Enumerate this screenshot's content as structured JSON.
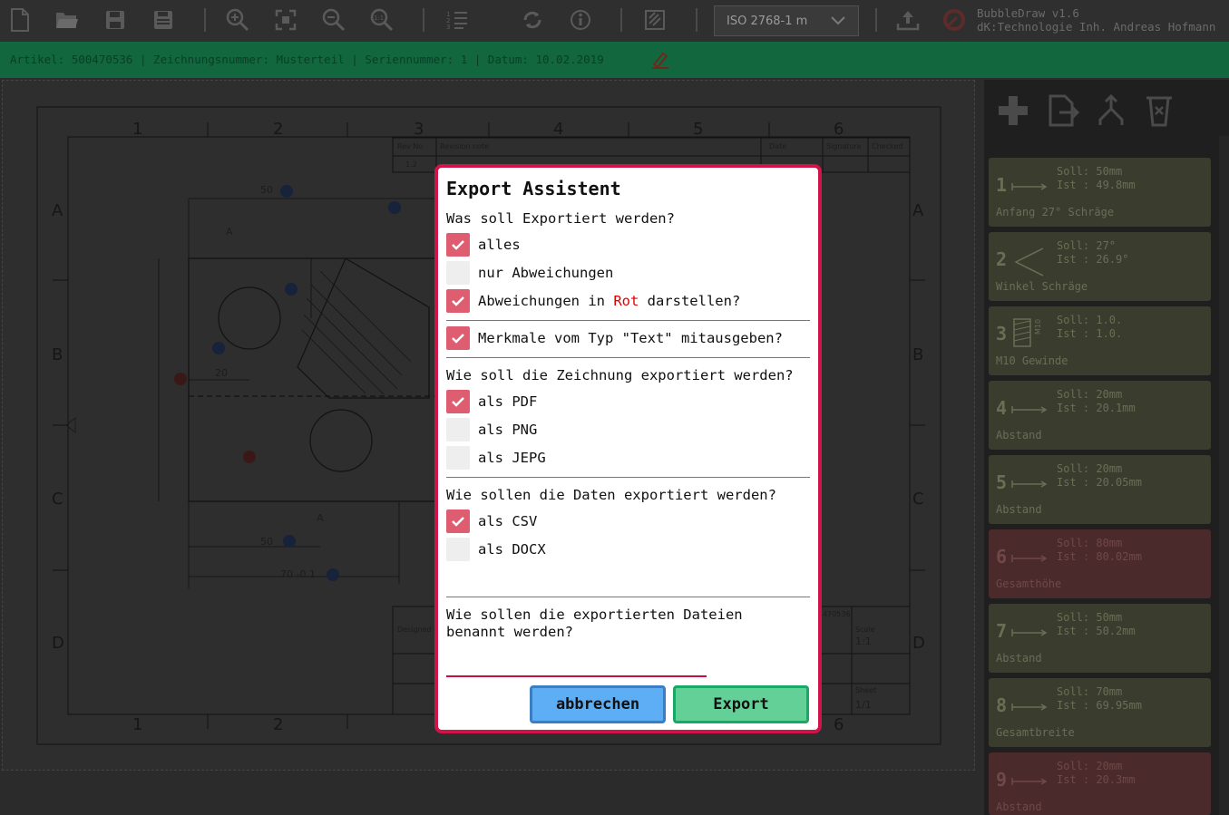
{
  "toolbar": {
    "icons": [
      "new-file-icon",
      "open-folder-icon",
      "save-icon",
      "save-as-icon",
      "zoom-in-icon",
      "zoom-fit-icon",
      "zoom-out-icon",
      "zoom-reset-icon",
      "list-numbered-icon",
      "refresh-icon",
      "info-icon",
      "page-icon",
      "upload-icon",
      "bubbledraw-logo"
    ],
    "norm_select": "ISO 2768-1 m",
    "app_title": "BubbleDraw v1.6",
    "app_company": "dK:Technologie Inh. Andreas Hofmann"
  },
  "infobar": {
    "text": "Artikel: 500470536 | Zeichnungsnummer: Musterteil | Seriennummer: 1 | Datum: 10.02.2019"
  },
  "drawing": {
    "grid_cols": [
      "1",
      "2",
      "3",
      "4",
      "5",
      "6"
    ],
    "grid_rows": [
      "A",
      "B",
      "C",
      "D"
    ],
    "title_block": {
      "rev_no": "Rev No",
      "revision_note": "Revision note",
      "date": "Date",
      "signature": "Signature",
      "checked": "Checked",
      "rev_value": "1.2",
      "designed_by": "Designed by",
      "scale_label": "Scale",
      "scale_value": "1:1",
      "sheet_label": "Sheet",
      "sheet_value": "1/1",
      "drawing_no_fragment": "470536"
    },
    "dims": [
      "50",
      "20",
      "20",
      "20",
      "25",
      "27°",
      "100",
      "50",
      "70 -0.1",
      "90 -0.1",
      "20",
      "A",
      "A"
    ]
  },
  "sidebar": {
    "tools": [
      "add-icon",
      "import-icon",
      "merge-icon",
      "delete-icon"
    ],
    "cards": [
      {
        "num": "1",
        "soll": "Soll: 50mm",
        "ist": "Ist : 49.8mm",
        "desc": "Anfang 27° Schräge",
        "symbol": "distance-icon",
        "status": "ok"
      },
      {
        "num": "2",
        "soll": "Soll: 27°",
        "ist": "Ist : 26.9°",
        "desc": "Winkel Schräge",
        "symbol": "angle-icon",
        "status": "ok"
      },
      {
        "num": "3",
        "soll": "Soll: 1.0.",
        "ist": "Ist : 1.0.",
        "desc": "M10 Gewinde",
        "symbol": "thread-icon",
        "status": "ok"
      },
      {
        "num": "4",
        "soll": "Soll: 20mm",
        "ist": "Ist : 20.1mm",
        "desc": "Abstand",
        "symbol": "distance-icon",
        "status": "ok"
      },
      {
        "num": "5",
        "soll": "Soll: 20mm",
        "ist": "Ist : 20.05mm",
        "desc": "Abstand",
        "symbol": "distance-icon",
        "status": "ok"
      },
      {
        "num": "6",
        "soll": "Soll: 80mm",
        "ist": "Ist : 80.02mm",
        "desc": "Gesamthöhe",
        "symbol": "distance-icon",
        "status": "bad"
      },
      {
        "num": "7",
        "soll": "Soll: 50mm",
        "ist": "Ist : 50.2mm",
        "desc": "Abstand",
        "symbol": "distance-icon",
        "status": "ok"
      },
      {
        "num": "8",
        "soll": "Soll: 70mm",
        "ist": "Ist : 69.95mm",
        "desc": "Gesamtbreite",
        "symbol": "distance-icon",
        "status": "ok"
      },
      {
        "num": "9",
        "soll": "Soll: 20mm",
        "ist": "Ist : 20.3mm",
        "desc": "Abstand",
        "symbol": "distance-icon",
        "status": "bad"
      }
    ]
  },
  "modal": {
    "title": "Export Assistent",
    "q1": "Was soll Exportiert werden?",
    "opt_alles": "alles",
    "opt_nur": "nur Abweichungen",
    "opt_rot_a": "Abweichungen in ",
    "opt_rot_b": "Rot",
    "opt_rot_c": " darstellen?",
    "opt_text": "Merkmale vom Typ \"Text\" mitausgeben?",
    "q2": "Wie soll die Zeichnung exportiert werden?",
    "opt_pdf": "als PDF",
    "opt_png": "als PNG",
    "opt_jepg": "als JEPG",
    "q3": "Wie sollen die Daten exportiert werden?",
    "opt_csv": "als CSV",
    "opt_docx": "als DOCX",
    "q4": "Wie sollen die exportierten Dateien benannt werden?",
    "filename_value": "",
    "checked": {
      "alles": true,
      "nur": false,
      "rot": true,
      "text": true,
      "pdf": true,
      "png": false,
      "jepg": false,
      "csv": true,
      "docx": false
    },
    "btn_cancel": "abbrechen",
    "btn_export": "Export"
  },
  "colors": {
    "accent": "#d0144a",
    "checkbox_on": "#df5d70",
    "infobar": "#12673f",
    "cancel": "#5eaef5",
    "export": "#63d197"
  }
}
